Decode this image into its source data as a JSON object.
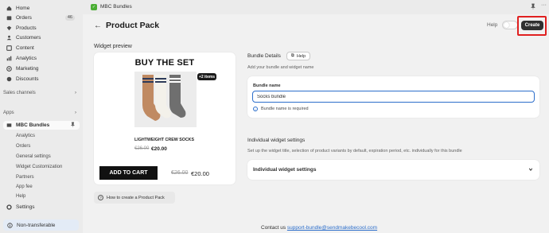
{
  "sidebar": {
    "nav": [
      {
        "label": "Home",
        "icon": "home-icon"
      },
      {
        "label": "Orders",
        "icon": "orders-icon",
        "badge": "46"
      },
      {
        "label": "Products",
        "icon": "products-icon"
      },
      {
        "label": "Customers",
        "icon": "customers-icon"
      },
      {
        "label": "Content",
        "icon": "content-icon"
      },
      {
        "label": "Analytics",
        "icon": "analytics-icon"
      },
      {
        "label": "Marketing",
        "icon": "marketing-icon"
      },
      {
        "label": "Discounts",
        "icon": "discounts-icon"
      }
    ],
    "sales_channels": "Sales channels",
    "apps": "Apps",
    "active_app": "MBC Bundles",
    "app_subitems": [
      "Analytics",
      "Orders",
      "General settings",
      "Widget Customization",
      "Partners",
      "App fee",
      "Help"
    ],
    "settings": "Settings",
    "non_transferable": "Non-transferable"
  },
  "topbar": {
    "app_name": "MBC Bundles"
  },
  "header": {
    "title": "Product Pack",
    "help_label": "Help",
    "create_label": "Create"
  },
  "preview": {
    "section_label": "Widget preview",
    "headline": "BUY THE SET",
    "items_badge": "+2 items",
    "product_name": "LIGHTWEIGHT CREW SOCKS",
    "old_price": "€26.00",
    "new_price": "€20.00",
    "add_to_cart": "ADD TO CART",
    "old_price_2": "€26.00",
    "new_price_2": "€20.00",
    "howto": "How to create a Product Pack"
  },
  "bundle_details": {
    "title": "Bundle Details",
    "help_chip": "Help",
    "subtitle": "Add your bundle and widget name",
    "name_label": "Bundle name",
    "name_value": "Socks bundle",
    "error": "Bundle name is required"
  },
  "individual": {
    "title": "Individual widget settings",
    "subtitle": "Set up the widget title, selection of product variants by default, expiration period, etc. individually for this bundle",
    "card_label": "Individual widget settings"
  },
  "footer": {
    "contact_prefix": "Contact us",
    "email": "support-bundle@sendmakebecool.com"
  },
  "colors": {
    "primary": "#303030",
    "link": "#2c6ecb",
    "highlight_box": "#e02020",
    "app_logo": "#4bae34"
  }
}
